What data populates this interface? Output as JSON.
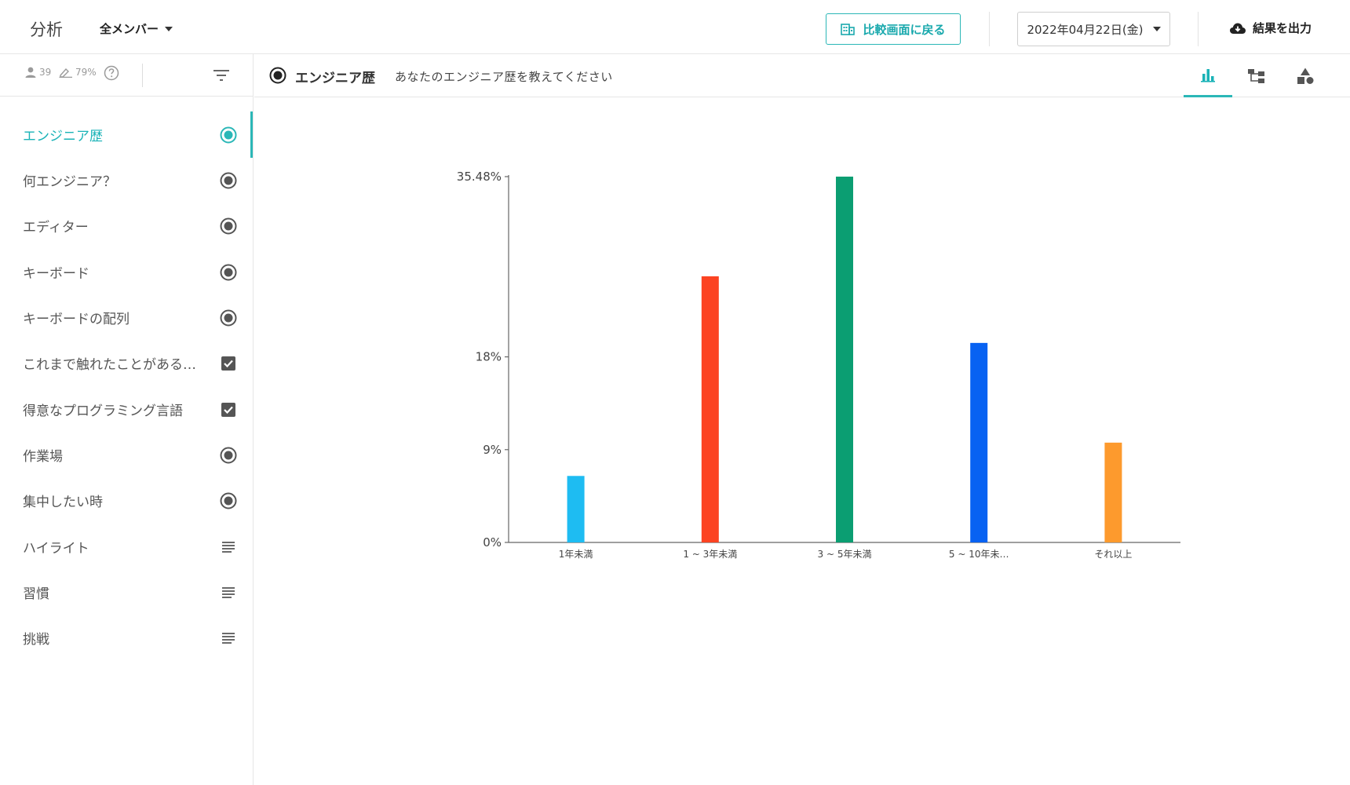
{
  "header": {
    "app_title": "分析",
    "member_filter": "全メンバー",
    "back_button": "比較画面に戻る",
    "date": "2022年04月22日(金)",
    "export_button": "結果を出力"
  },
  "sidebar": {
    "respondents": "39",
    "response_rate": "79%",
    "items": [
      {
        "label": "エンジニア歴",
        "type": "radio",
        "icon": "radio-icon"
      },
      {
        "label": "何エンジニア？",
        "type": "radio",
        "icon": "radio-icon"
      },
      {
        "label": "エディター",
        "type": "radio",
        "icon": "radio-icon"
      },
      {
        "label": "キーボード",
        "type": "radio",
        "icon": "radio-icon"
      },
      {
        "label": "キーボードの配列",
        "type": "radio",
        "icon": "radio-icon"
      },
      {
        "label": "これまで触れたことがある…",
        "type": "checkbox",
        "icon": "checkbox-icon"
      },
      {
        "label": "得意なプログラミング言語",
        "type": "checkbox",
        "icon": "checkbox-icon"
      },
      {
        "label": "作業場",
        "type": "radio",
        "icon": "radio-icon"
      },
      {
        "label": "集中したい時",
        "type": "radio",
        "icon": "radio-icon"
      },
      {
        "label": "ハイライト",
        "type": "text",
        "icon": "text-lines-icon"
      },
      {
        "label": "習慣",
        "type": "text",
        "icon": "text-lines-icon"
      },
      {
        "label": "挑戦",
        "type": "text",
        "icon": "text-lines-icon"
      }
    ]
  },
  "question": {
    "title": "エンジニア歴",
    "description": "あなたのエンジニア歴を教えてください"
  },
  "colors": {
    "accent": "#2bb7b7",
    "bars": [
      "#1ebcf2",
      "#fc4322",
      "#0b9e72",
      "#0862f2",
      "#fd9a2d"
    ]
  },
  "chart_data": {
    "type": "bar",
    "categories": [
      "1年未満",
      "1 ~ 3年未満",
      "3 ~ 5年未満",
      "5 ~ 10年未…",
      "それ以上"
    ],
    "values": [
      6.45,
      25.81,
      35.48,
      19.35,
      9.68
    ],
    "yticks": [
      0,
      9,
      18,
      35.48
    ],
    "ytick_labels": [
      "0%",
      "9%",
      "18%",
      "35.48%"
    ],
    "ylim": [
      0,
      35.48
    ],
    "grid": false
  }
}
